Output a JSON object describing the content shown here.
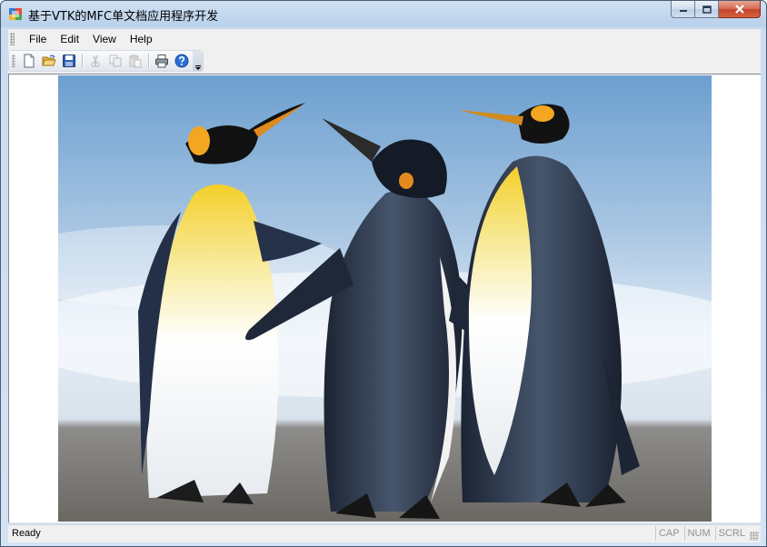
{
  "window": {
    "title": "基于VTK的MFC单文档应用程序开发",
    "app_icon": "mfc-app-icon",
    "caption_buttons": [
      "minimize-icon",
      "maximize-icon",
      "close-icon"
    ]
  },
  "menu": {
    "items": [
      {
        "label": "File"
      },
      {
        "label": "Edit"
      },
      {
        "label": "View"
      },
      {
        "label": "Help"
      }
    ]
  },
  "toolbar": {
    "buttons": [
      {
        "icon": "new-document-icon",
        "enabled": true
      },
      {
        "icon": "open-folder-icon",
        "enabled": true
      },
      {
        "icon": "save-icon",
        "enabled": true
      },
      {
        "icon": "cut-icon",
        "enabled": false
      },
      {
        "icon": "copy-icon",
        "enabled": false
      },
      {
        "icon": "paste-icon",
        "enabled": false
      },
      {
        "icon": "print-icon",
        "enabled": true
      },
      {
        "icon": "help-icon",
        "enabled": true
      }
    ],
    "overflow_icon": "toolbar-overflow-chevron-icon"
  },
  "view": {
    "image_subject": "three emperor penguins standing on a beach"
  },
  "statusbar": {
    "text": "Ready",
    "indicators": [
      "CAP",
      "NUM",
      "SCRL"
    ]
  },
  "colors": {
    "titlebar": "#b9d1ea",
    "close_button": "#c3442a",
    "chrome": "#f0f0f0"
  }
}
